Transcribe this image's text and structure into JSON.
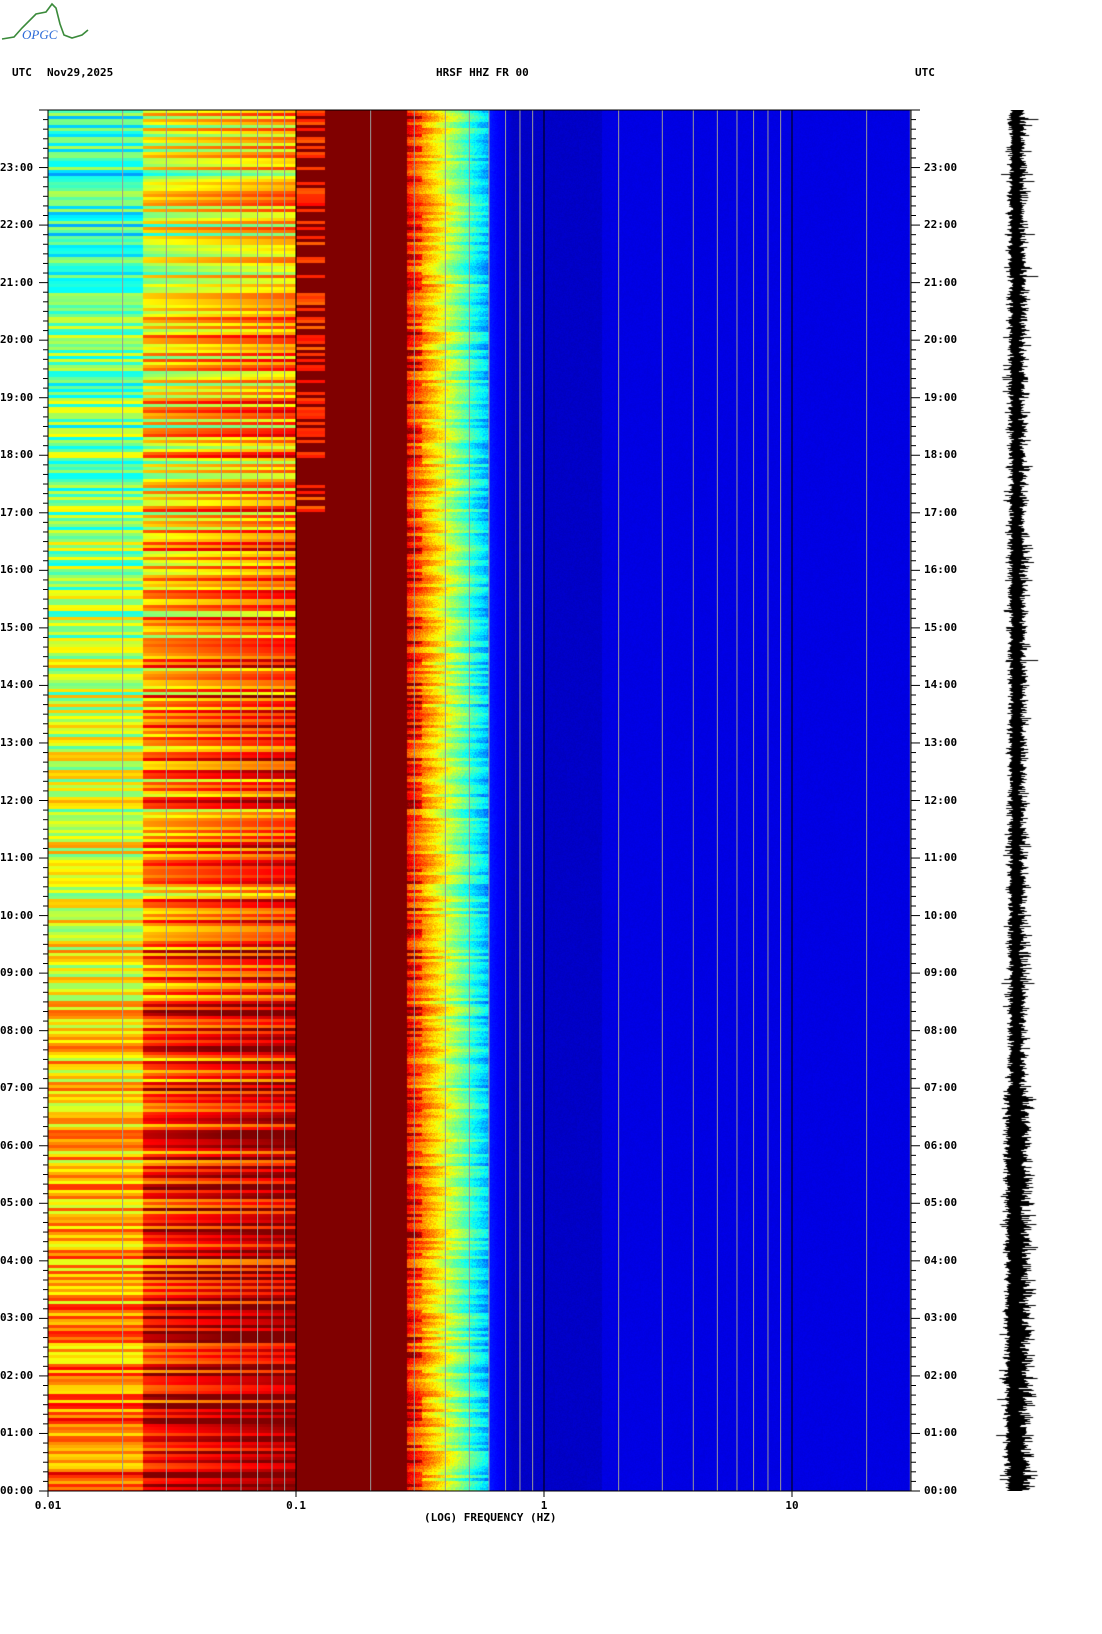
{
  "logo": {
    "text": "OPGC"
  },
  "header": {
    "left_tz": "UTC",
    "date": "Nov29,2025",
    "title": "HRSF HHZ FR 00",
    "right_tz": "UTC"
  },
  "chart_data": {
    "type": "heatmap",
    "title": "HRSF HHZ FR 00",
    "subtitle": "Nov29,2025",
    "xlabel": "(LOG) FREQUENCY (HZ)",
    "ylabel": "UTC",
    "xscale": "log",
    "xlim": [
      0.01,
      30
    ],
    "ylim_hours": [
      0,
      24
    ],
    "colormap": "jet",
    "xticks": [
      {
        "value": 0.01,
        "label": "0.01"
      },
      {
        "value": 0.1,
        "label": "0.1"
      },
      {
        "value": 1,
        "label": "1"
      },
      {
        "value": 10,
        "label": "10"
      }
    ],
    "yticks": [
      {
        "hour": 0,
        "label": "00:00"
      },
      {
        "hour": 1,
        "label": "01:00"
      },
      {
        "hour": 2,
        "label": "02:00"
      },
      {
        "hour": 3,
        "label": "03:00"
      },
      {
        "hour": 4,
        "label": "04:00"
      },
      {
        "hour": 5,
        "label": "05:00"
      },
      {
        "hour": 6,
        "label": "06:00"
      },
      {
        "hour": 7,
        "label": "07:00"
      },
      {
        "hour": 8,
        "label": "08:00"
      },
      {
        "hour": 9,
        "label": "09:00"
      },
      {
        "hour": 10,
        "label": "10:00"
      },
      {
        "hour": 11,
        "label": "11:00"
      },
      {
        "hour": 12,
        "label": "12:00"
      },
      {
        "hour": 13,
        "label": "13:00"
      },
      {
        "hour": 14,
        "label": "14:00"
      },
      {
        "hour": 15,
        "label": "15:00"
      },
      {
        "hour": 16,
        "label": "16:00"
      },
      {
        "hour": 17,
        "label": "17:00"
      },
      {
        "hour": 18,
        "label": "18:00"
      },
      {
        "hour": 19,
        "label": "19:00"
      },
      {
        "hour": 20,
        "label": "20:00"
      },
      {
        "hour": 21,
        "label": "21:00"
      },
      {
        "hour": 22,
        "label": "22:00"
      },
      {
        "hour": 23,
        "label": "23:00"
      }
    ],
    "bands": [
      {
        "fmin": 0.01,
        "fmax": 0.024,
        "level_at_00h": 0.78,
        "level_at_24h": 0.4
      },
      {
        "fmin": 0.024,
        "fmax": 0.1,
        "level_at_00h": 0.9,
        "level_at_24h": 0.55
      },
      {
        "fmin": 0.1,
        "fmax": 0.28,
        "level": 1.0
      },
      {
        "fmin": 0.28,
        "fmax": 0.6,
        "level_start": 0.85,
        "level_end": 0.3
      },
      {
        "fmin": 0.6,
        "fmax": 1.7,
        "level": 0.06
      },
      {
        "fmin": 1.7,
        "fmax": 30,
        "level": 0.09
      }
    ],
    "grid": true
  }
}
